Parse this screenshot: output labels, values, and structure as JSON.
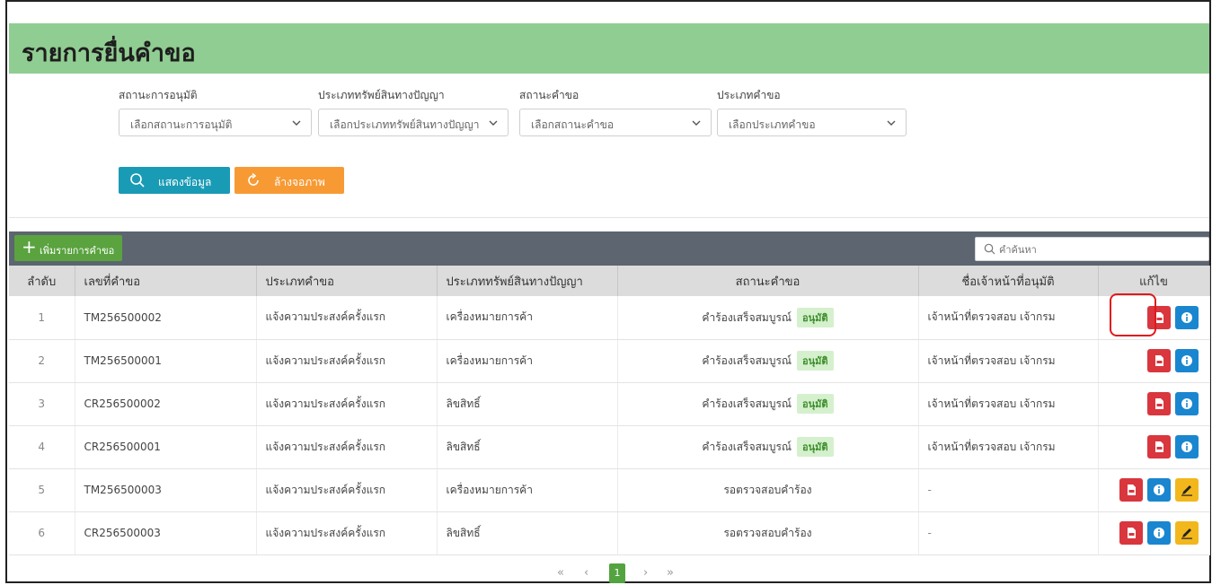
{
  "page_title": "รายการยื่นคำขอ",
  "filters": [
    {
      "label": "สถานะการอนุมัติ",
      "placeholder": "เลือกสถานะการอนุมัติ"
    },
    {
      "label": "ประเภททรัพย์สินทางปัญญา",
      "placeholder": "เลือกประเภททรัพย์สินทางปัญญา"
    },
    {
      "label": "สถานะคำขอ",
      "placeholder": "เลือกสถานะคำขอ"
    },
    {
      "label": "ประเภทคำขอ",
      "placeholder": "เลือกประเภทคำขอ"
    }
  ],
  "buttons": {
    "show": "แสดงข้อมูล",
    "clear": "ล้างจอภาพ",
    "add": "เพิ่มรายการคำขอ"
  },
  "search": {
    "placeholder": "คำค้นหา"
  },
  "table": {
    "headers": [
      "ลำดับ",
      "เลขที่คำขอ",
      "ประเภทคำขอ",
      "ประเภททรัพย์สินทางปัญญา",
      "สถานะคำขอ",
      "ชื่อเจ้าหน้าที่อนุมัติ",
      "แก้ไข"
    ],
    "rows": [
      {
        "no": "1",
        "id": "TM256500002",
        "type": "แจ้งความประสงค์ครั้งแรก",
        "ip": "เครื่องหมายการค้า",
        "status": "คำร้องเสร็จสมบูรณ์",
        "badge": "อนุมัติ",
        "officer": "เจ้าหน้าที่ตรวจสอบ เจ้ากรม"
      },
      {
        "no": "2",
        "id": "TM256500001",
        "type": "แจ้งความประสงค์ครั้งแรก",
        "ip": "เครื่องหมายการค้า",
        "status": "คำร้องเสร็จสมบูรณ์",
        "badge": "อนุมัติ",
        "officer": "เจ้าหน้าที่ตรวจสอบ เจ้ากรม"
      },
      {
        "no": "3",
        "id": "CR256500002",
        "type": "แจ้งความประสงค์ครั้งแรก",
        "ip": "ลิขสิทธิ์",
        "status": "คำร้องเสร็จสมบูรณ์",
        "badge": "อนุมัติ",
        "officer": "เจ้าหน้าที่ตรวจสอบ เจ้ากรม"
      },
      {
        "no": "4",
        "id": "CR256500001",
        "type": "แจ้งความประสงค์ครั้งแรก",
        "ip": "ลิขสิทธิ์",
        "status": "คำร้องเสร็จสมบูรณ์",
        "badge": "อนุมัติ",
        "officer": "เจ้าหน้าที่ตรวจสอบ เจ้ากรม"
      },
      {
        "no": "5",
        "id": "TM256500003",
        "type": "แจ้งความประสงค์ครั้งแรก",
        "ip": "เครื่องหมายการค้า",
        "status": "รอตรวจสอบคำร้อง",
        "badge": "",
        "officer": "-"
      },
      {
        "no": "6",
        "id": "CR256500003",
        "type": "แจ้งความประสงค์ครั้งแรก",
        "ip": "ลิขสิทธิ์",
        "status": "รอตรวจสอบคำร้อง",
        "badge": "",
        "officer": "-"
      }
    ]
  },
  "pagination": {
    "first": "«",
    "prev": "‹",
    "current": "1",
    "next": "›",
    "last": "»"
  },
  "colors": {
    "header_green": "#90cd92",
    "toolbar": "#5c6570",
    "red": "#d9363e",
    "blue": "#1a86d0",
    "yellow": "#f2b71c",
    "teal": "#1a9bb5",
    "orange": "#f79a34"
  }
}
